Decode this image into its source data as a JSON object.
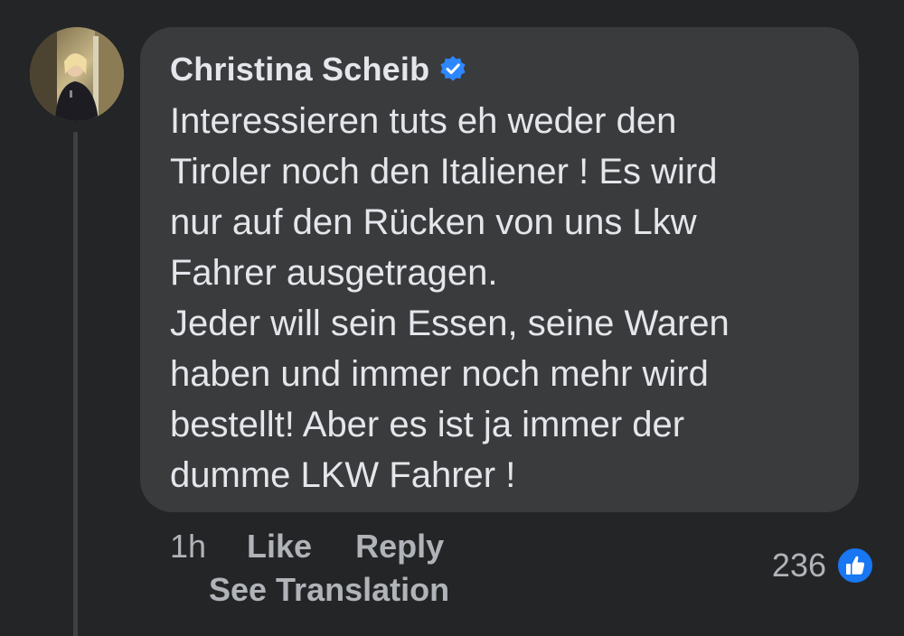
{
  "comment": {
    "author": "Christina Scheib",
    "verified_icon": "verified-badge-icon",
    "text": "Interessieren tuts eh weder den\nTiroler noch den Italiener ! Es wird\nnur auf den Rücken von uns Lkw\nFahrer ausgetragen.\nJeder will sein Essen, seine Waren\nhaben und immer noch mehr wird\nbestellt! Aber es ist ja immer der\ndumme LKW Fahrer !",
    "time": "1h",
    "like_label": "Like",
    "reply_label": "Reply",
    "see_translation_label": "See Translation",
    "reaction_count": "236",
    "reaction_icon": "like-reaction-icon"
  },
  "colors": {
    "background": "#242526",
    "bubble": "#3a3b3c",
    "text": "#e4e6eb",
    "secondary_text": "#b0b3b8",
    "accent_blue": "#2d88ff"
  }
}
